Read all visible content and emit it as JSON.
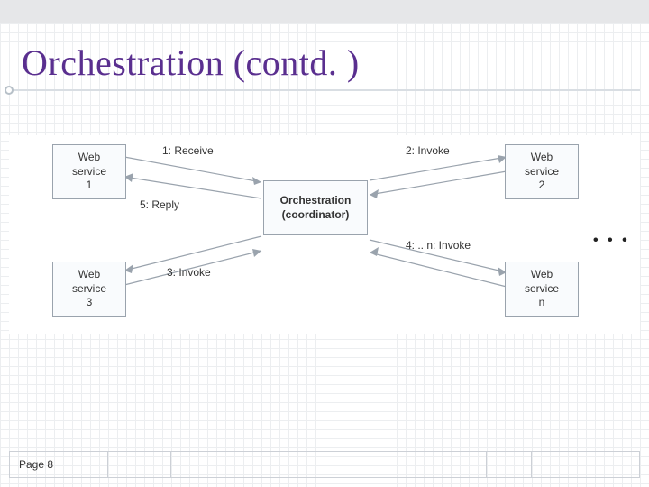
{
  "title": "Orchestration (contd. )",
  "footer": {
    "page_label": "Page 8"
  },
  "nodes": {
    "ws1": {
      "line1": "Web service",
      "line2": "1"
    },
    "ws2": {
      "line1": "Web service",
      "line2": "2"
    },
    "ws3": {
      "line1": "Web service",
      "line2": "3"
    },
    "wsn": {
      "line1": "Web service",
      "line2": "n"
    },
    "center": {
      "line1": "Orchestration",
      "line2": "(coordinator)"
    }
  },
  "labels": {
    "receive": "1: Receive",
    "invoke2": "2: Invoke",
    "invoke3": "3: Invoke",
    "invoke_n": "4: .. n: Invoke",
    "reply": "5: Reply"
  },
  "ellipsis": "• • •"
}
